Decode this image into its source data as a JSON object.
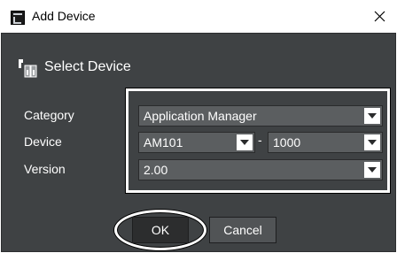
{
  "window": {
    "title": "Add Device",
    "close_icon": "close-icon",
    "app_icon": "app-icon"
  },
  "dialog": {
    "header": "Select Device",
    "header_icon": "device-icon"
  },
  "fields": {
    "category_label": "Category",
    "category_value": "Application Manager",
    "device_label": "Device",
    "device_value": "AM101",
    "device_separator": "-",
    "port_value": "1000",
    "version_label": "Version",
    "version_value": "2.00"
  },
  "buttons": {
    "ok": "OK",
    "cancel": "Cancel"
  },
  "colors": {
    "panel": "#3f4244",
    "combo": "#5b5e60",
    "text": "#ffffff",
    "highlight": "#ffffff"
  }
}
